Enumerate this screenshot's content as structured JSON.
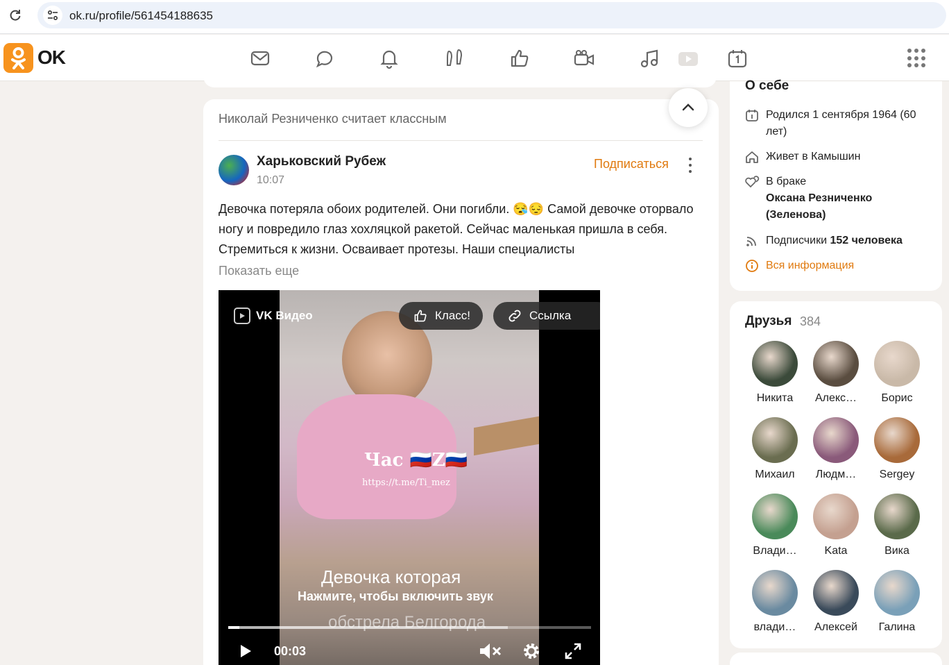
{
  "browser": {
    "url": "ok.ru/profile/561454188635"
  },
  "header": {
    "logo_text": "OK",
    "brand_color": "#f7931e",
    "nav_icons": [
      "messages-icon",
      "discussions-icon",
      "notifications-icon",
      "guests-icon",
      "likes-icon",
      "video-call-icon",
      "music-icon",
      "video-icon",
      "events-icon"
    ]
  },
  "feed": {
    "activity_text": "Николай Резниченко считает классным",
    "post": {
      "group_name": "Харьковский Рубеж",
      "time": "10:07",
      "subscribe_label": "Подписаться",
      "text": "Девочка потеряла обоих родителей.  Они погибли. 😪😔 Самой девочке оторвало ногу и повредило глаз хохляцкой ракетой. Сейчас маленькая пришла в себя. Стремиться к жизни. Осваивает протезы. Наши специалисты",
      "show_more": "Показать еще",
      "video": {
        "provider": "VK Видео",
        "like_label": "Класс!",
        "link_label": "Ссылка",
        "watermark": "Час 🇷🇺Z🇷🇺",
        "watermark_link": "https://t.me/Ti_mez",
        "caption_line1": "Девочка которая",
        "tap_sound": "Нажмите, чтобы включить звук",
        "caption_line3": "обстрела Белгорода",
        "current_time": "00:03",
        "progress": 0.03,
        "buffered": 0.77
      }
    }
  },
  "about": {
    "title": "О себе",
    "born": "Родился 1 сентября 1964 (60 лет)",
    "lives": "Живет в Камышин",
    "marital_label": "В браке",
    "spouse": "Оксана Резниченко (Зеленова)",
    "subscribers_label": "Подписчики",
    "subscribers_value": "152 человека",
    "all_info": "Вся информация"
  },
  "friends": {
    "title": "Друзья",
    "count": "384",
    "items": [
      {
        "name": "Никита",
        "color": "#3b4a3a"
      },
      {
        "name": "Алекс…",
        "color": "#5a4d40"
      },
      {
        "name": "Борис",
        "color": "#c9b9a8"
      },
      {
        "name": "Михаил",
        "color": "#6a6d50"
      },
      {
        "name": "Людм…",
        "color": "#8a5a7a"
      },
      {
        "name": "Sergey",
        "color": "#a86a3a"
      },
      {
        "name": "Влади…",
        "color": "#4a8a5a"
      },
      {
        "name": "Kata",
        "color": "#c4a090"
      },
      {
        "name": "Вика",
        "color": "#5a6a4a"
      },
      {
        "name": "влади…",
        "color": "#6a8aa0"
      },
      {
        "name": "Алексей",
        "color": "#3a4a5a"
      },
      {
        "name": "Галина",
        "color": "#7aa0b8"
      }
    ]
  }
}
